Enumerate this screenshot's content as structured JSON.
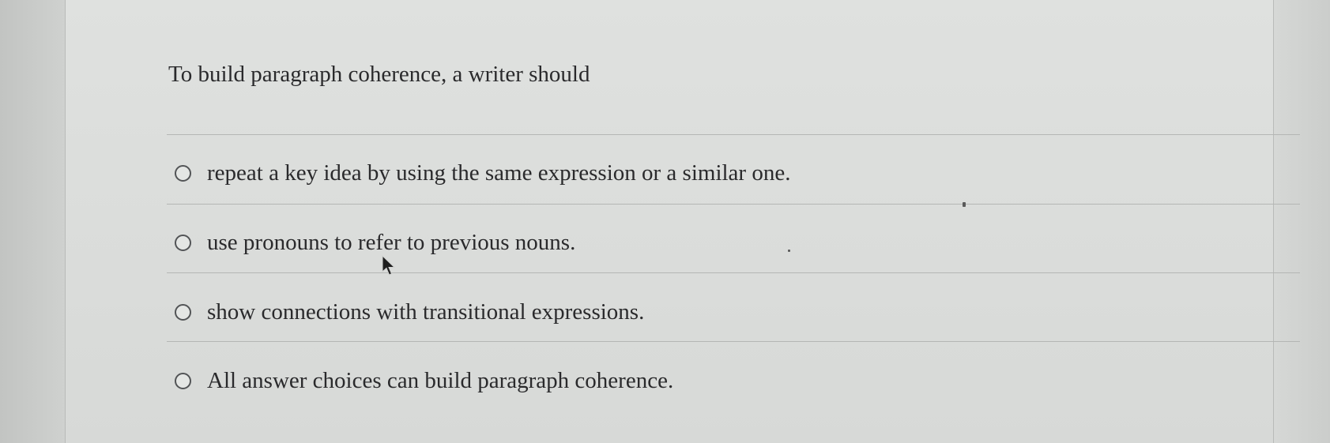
{
  "question": {
    "stem": "To build paragraph coherence, a writer should"
  },
  "options": [
    {
      "label": "repeat a key idea by using the same expression or a similar one.",
      "selected": false
    },
    {
      "label": "use pronouns to refer to previous nouns.",
      "selected": false
    },
    {
      "label": "show connections with transitional expressions.",
      "selected": false
    },
    {
      "label": "All answer choices can build paragraph coherence.",
      "selected": false
    }
  ],
  "icons": {
    "radio": "radio-button-icon",
    "cursor": "mouse-pointer-icon"
  },
  "colors": {
    "panel_background": "#dcdedc",
    "text": "#2a2a2c",
    "divider": "#b4b6b4",
    "radio_border": "#525456"
  }
}
